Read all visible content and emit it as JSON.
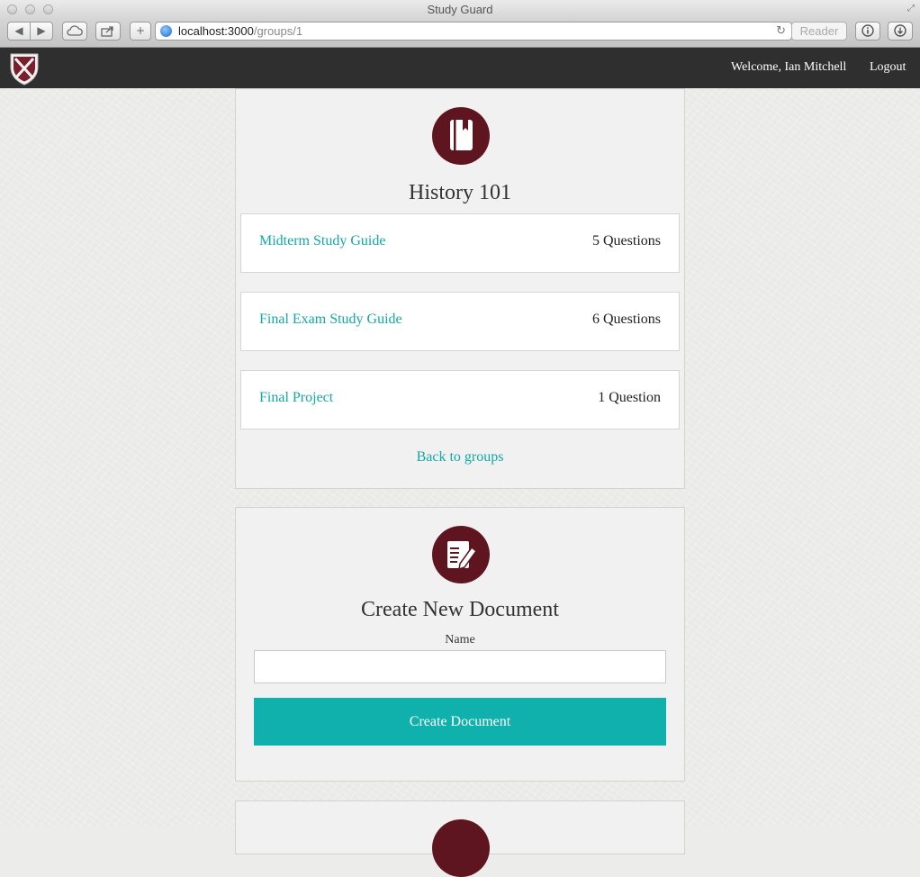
{
  "window": {
    "title": "Study Guard"
  },
  "browser": {
    "url_host": "localhost:3000",
    "url_path": "/groups/1",
    "reader_label": "Reader"
  },
  "navbar": {
    "welcome": "Welcome, Ian Mitchell",
    "logout": "Logout"
  },
  "group": {
    "title": "History 101",
    "documents": [
      {
        "name": "Midterm Study Guide",
        "count": "5 Questions"
      },
      {
        "name": "Final Exam Study Guide",
        "count": "6 Questions"
      },
      {
        "name": "Final Project",
        "count": "1 Question"
      }
    ],
    "back_label": "Back to groups"
  },
  "create_document": {
    "title": "Create New Document",
    "name_label": "Name",
    "name_value": "",
    "submit_label": "Create Document"
  },
  "colors": {
    "accent_teal": "#14a8a4",
    "button_teal": "#10b1ad",
    "icon_maroon": "#5e1520",
    "navbar": "#2f2f2f"
  },
  "icons": {
    "logo": "shield-logo-icon",
    "group": "notebook-icon",
    "create": "edit-document-icon"
  }
}
